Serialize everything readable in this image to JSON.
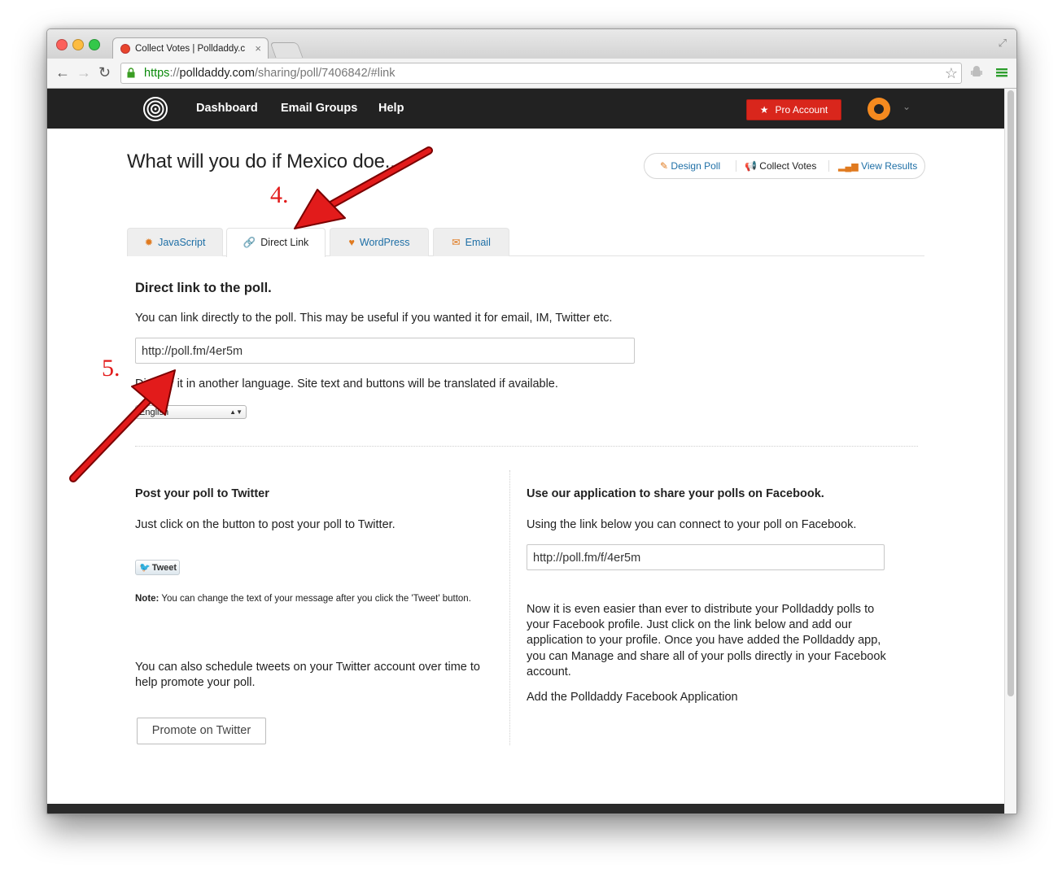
{
  "browser": {
    "tab_title": "Collect Votes | Polldaddy.c",
    "tab_close": "×",
    "url_scheme": "https",
    "url_sep": "://",
    "url_host": "polldaddy.com",
    "url_path": "/sharing/poll/7406842/#link"
  },
  "sitenav": {
    "links": [
      "Dashboard",
      "Email Groups",
      "Help"
    ],
    "pro_button": "Pro Account"
  },
  "page": {
    "title": "What will you do if Mexico doe...",
    "actions": [
      "Design Poll",
      "Collect Votes",
      "View Results"
    ]
  },
  "tabs": [
    {
      "label": "JavaScript",
      "active": false
    },
    {
      "label": "Direct Link",
      "active": true
    },
    {
      "label": "WordPress",
      "active": false
    },
    {
      "label": "Email",
      "active": false
    }
  ],
  "direct_link": {
    "heading": "Direct link to the poll.",
    "description": "You can link directly to the poll. This may be useful if you wanted it for email, IM, Twitter etc.",
    "url_value": "http://poll.fm/4er5m",
    "language_text": "Display it in another language. Site text and buttons will be translated if available.",
    "language_selected": "English"
  },
  "twitter": {
    "heading": "Post your poll to Twitter",
    "description": "Just click on the button to post your poll to Twitter.",
    "tweet_button": "Tweet",
    "note_label": "Note:",
    "note_text": "You can change the text of your message after you click the 'Tweet' button.",
    "schedule_text": "You can also schedule tweets on your Twitter account over time to help promote your poll.",
    "promote_button": "Promote on Twitter"
  },
  "facebook": {
    "heading": "Use our application to share your polls on Facebook.",
    "description": "Using the link below you can connect to your poll on Facebook.",
    "url_value": "http://poll.fm/f/4er5m",
    "body": "Now it is even easier than ever to distribute your Polldaddy polls to your Facebook profile. Just click on the link below and add our application to your profile. Once you have added the Polldaddy app, you can Manage and share all of your polls directly in your Facebook account.",
    "app_link": "Add the Polldaddy Facebook Application"
  },
  "annotations": [
    "4.",
    "5."
  ],
  "colors": {
    "nav_bg": "#222222",
    "pro_button": "#d9261c",
    "link": "#1e6fa6",
    "annotation": "#e21b1b",
    "avatar": "#f58a1f"
  }
}
